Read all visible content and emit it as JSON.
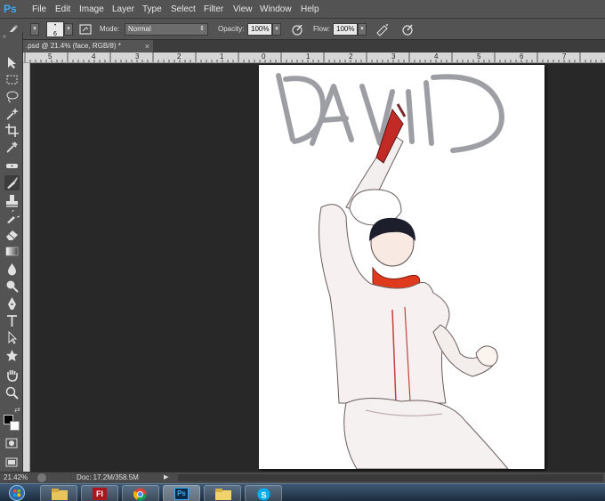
{
  "app": {
    "logo": "Ps"
  },
  "menu": [
    "File",
    "Edit",
    "Image",
    "Layer",
    "Type",
    "Select",
    "Filter",
    "View",
    "Window",
    "Help"
  ],
  "options": {
    "brush_size": "6",
    "mode_label": "Mode:",
    "mode_value": "Normal",
    "opacity_label": "Opacity:",
    "opacity_value": "100%",
    "flow_label": "Flow:",
    "flow_value": "100%"
  },
  "document_tab": {
    "title": ".psd @ 21.4% (face, RGB/8) *",
    "close": "×"
  },
  "rulers": {
    "top_labels": [
      "5",
      "4",
      "3",
      "2",
      "1",
      "0",
      "1",
      "2",
      "3",
      "4",
      "5",
      "6",
      "7"
    ]
  },
  "tools": [
    {
      "name": "move-tool-icon"
    },
    {
      "name": "marquee-tool-icon"
    },
    {
      "name": "lasso-tool-icon"
    },
    {
      "name": "quick-select-tool-icon"
    },
    {
      "name": "crop-tool-icon"
    },
    {
      "name": "eyedropper-tool-icon"
    },
    {
      "name": "healing-brush-tool-icon"
    },
    {
      "name": "brush-tool-icon"
    },
    {
      "name": "clone-stamp-tool-icon"
    },
    {
      "name": "history-brush-tool-icon"
    },
    {
      "name": "eraser-tool-icon"
    },
    {
      "name": "gradient-tool-icon"
    },
    {
      "name": "blur-tool-icon"
    },
    {
      "name": "dodge-tool-icon"
    },
    {
      "name": "pen-tool-icon"
    },
    {
      "name": "type-tool-icon"
    },
    {
      "name": "path-select-tool-icon"
    },
    {
      "name": "shape-tool-icon"
    },
    {
      "name": "hand-tool-icon"
    },
    {
      "name": "zoom-tool-icon"
    }
  ],
  "canvas": {
    "handwritten_text": "DAVID"
  },
  "status": {
    "zoom": "21.42%",
    "doc_info": "Doc: 17.2M/358.5M"
  },
  "taskbar": {
    "apps": [
      {
        "name": "start-orb-icon"
      },
      {
        "name": "explorer-icon"
      },
      {
        "name": "flash-icon",
        "label": "Fl"
      },
      {
        "name": "chrome-icon"
      },
      {
        "name": "photoshop-icon",
        "label": "Ps"
      },
      {
        "name": "folder-icon"
      },
      {
        "name": "skype-icon"
      }
    ]
  },
  "colors": {
    "accent": "#3da9f5",
    "panel": "#535353",
    "workspace": "#282828",
    "scarf": "#e03a1e"
  }
}
